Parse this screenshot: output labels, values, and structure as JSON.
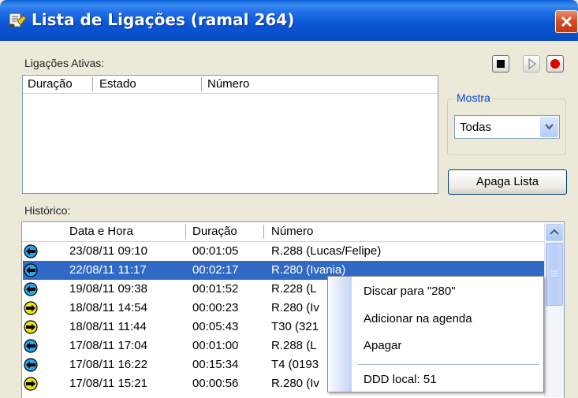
{
  "window": {
    "title": "Lista de Ligações (ramal 264)"
  },
  "active": {
    "label": "Ligações Ativas:",
    "columns": [
      "Duração",
      "Estado",
      "Número"
    ]
  },
  "toolbar": {
    "buttons": [
      "stop-icon",
      "play-icon",
      "record-icon"
    ]
  },
  "filter": {
    "group_label": "Mostra",
    "selected": "Todas"
  },
  "clear_button": "Apaga Lista",
  "history": {
    "label": "Histórico:",
    "columns": [
      "Data e Hora",
      "Duração",
      "Número"
    ],
    "rows": [
      {
        "datetime": "23/08/11  09:10",
        "duration": "00:01:05",
        "number": "R.288 (Lucas/Felipe)",
        "direction": "outgoing",
        "selected": false
      },
      {
        "datetime": "22/08/11  11:17",
        "duration": "00:02:17",
        "number": "R.280 (Ivania)",
        "direction": "outgoing",
        "selected": true
      },
      {
        "datetime": "19/08/11  09:38",
        "duration": "00:01:52",
        "number": "R.228 (L",
        "direction": "outgoing",
        "selected": false
      },
      {
        "datetime": "18/08/11  14:54",
        "duration": "00:00:23",
        "number": "R.280 (Iv",
        "direction": "incoming",
        "selected": false
      },
      {
        "datetime": "18/08/11  11:44",
        "duration": "00:05:43",
        "number": "T30 (321",
        "direction": "incoming",
        "selected": false
      },
      {
        "datetime": "17/08/11  17:04",
        "duration": "00:01:00",
        "number": "R.288 (L",
        "direction": "outgoing",
        "selected": false
      },
      {
        "datetime": "17/08/11  16:22",
        "duration": "00:15:34",
        "number": "T4 (0193",
        "direction": "outgoing",
        "selected": false
      },
      {
        "datetime": "17/08/11  15:21",
        "duration": "00:00:56",
        "number": "R.280 (Iv",
        "direction": "incoming",
        "selected": false
      }
    ]
  },
  "context_menu": {
    "items": [
      "Discar para  \"280\"",
      "Adicionar na agenda",
      "Apagar",
      "DDD local: 51"
    ]
  },
  "colors": {
    "selection": "#316ac5",
    "outgoing_icon": "#2aa5e6",
    "incoming_icon": "#f2e414"
  }
}
